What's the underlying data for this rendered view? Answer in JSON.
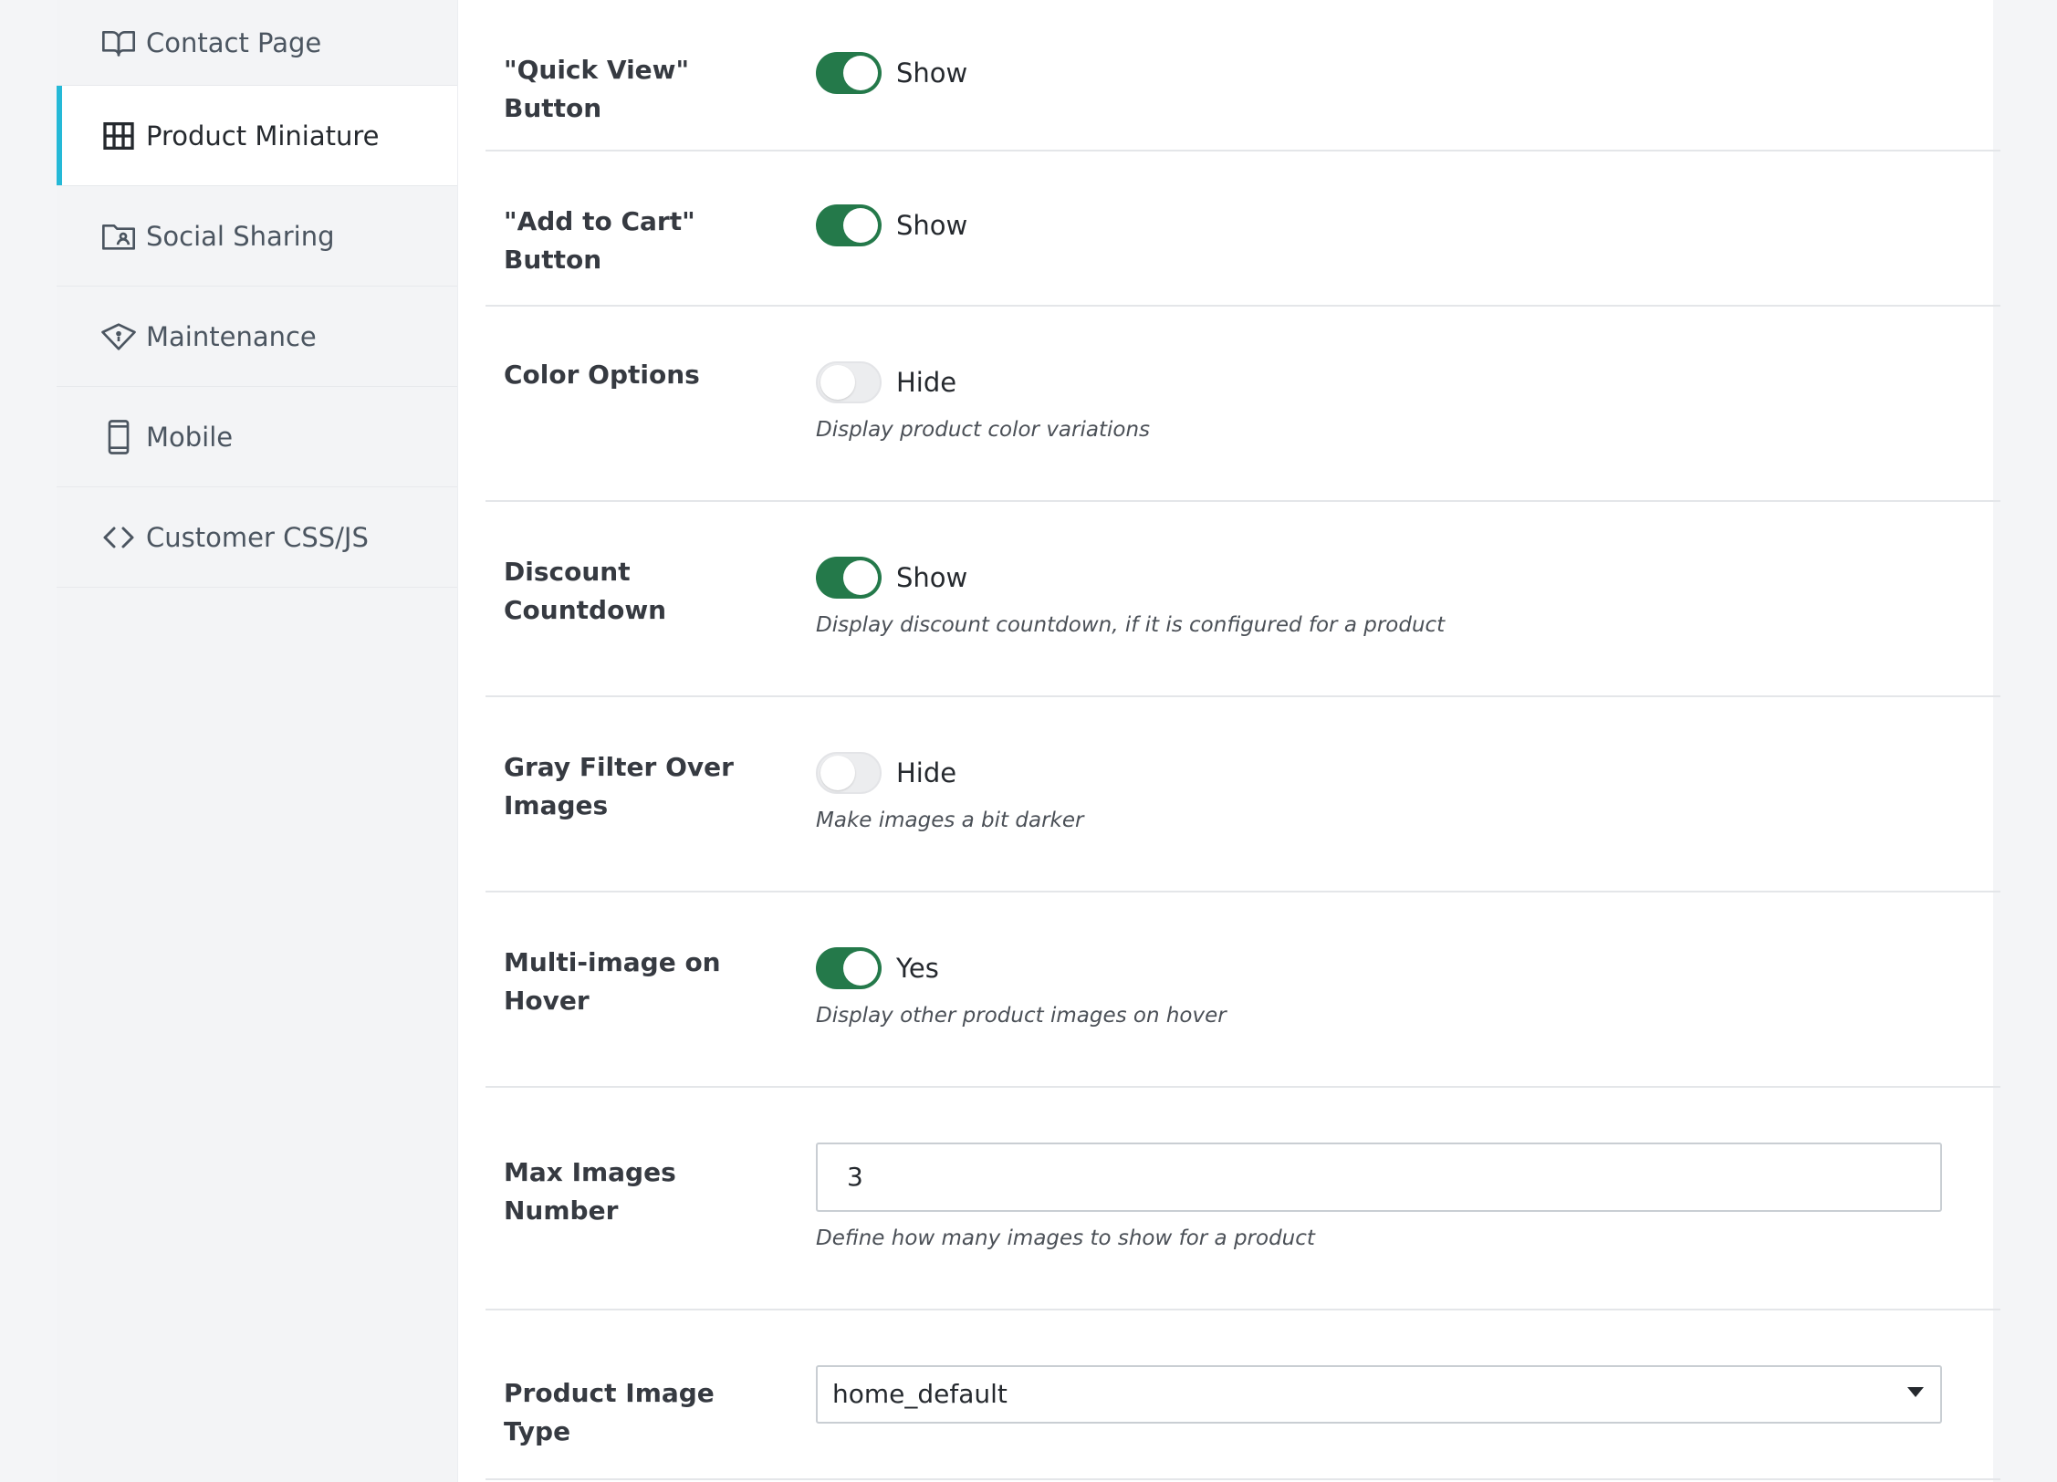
{
  "sidebar": {
    "items": [
      {
        "label": "Contact Page",
        "icon": "book-open-icon",
        "active": false
      },
      {
        "label": "Product Miniature",
        "icon": "grid-icon",
        "active": true
      },
      {
        "label": "Social Sharing",
        "icon": "folder-user-icon",
        "active": false
      },
      {
        "label": "Maintenance",
        "icon": "eye-icon",
        "active": false
      },
      {
        "label": "Mobile",
        "icon": "phone-icon",
        "active": false
      },
      {
        "label": "Customer CSS/JS",
        "icon": "code-icon",
        "active": false
      }
    ]
  },
  "settings": {
    "quick_view": {
      "label": "\"Quick View\" Button",
      "state": "Show",
      "on": true
    },
    "add_to_cart": {
      "label": "\"Add to Cart\" Button",
      "state": "Show",
      "on": true
    },
    "color_options": {
      "label": "Color Options",
      "state": "Hide",
      "on": false,
      "help": "Display product color variations"
    },
    "discount_countdown": {
      "label": "Discount Countdown",
      "state": "Show",
      "on": true,
      "help": "Display discount countdown, if it is configured for a product"
    },
    "gray_filter": {
      "label": "Gray Filter Over Images",
      "state": "Hide",
      "on": false,
      "help": "Make images a bit darker"
    },
    "multi_image": {
      "label": "Multi-image on Hover",
      "state": "Yes",
      "on": true,
      "help": "Display other product images on hover"
    },
    "max_images": {
      "label": "Max Images Number",
      "value": "3",
      "help": "Define how many images to show for a product"
    },
    "image_type": {
      "label": "Product Image Type",
      "value": "home_default"
    }
  },
  "colors": {
    "accent": "#25b9d7",
    "toggle_on": "#24794a",
    "toggle_off": "#ecedef"
  }
}
